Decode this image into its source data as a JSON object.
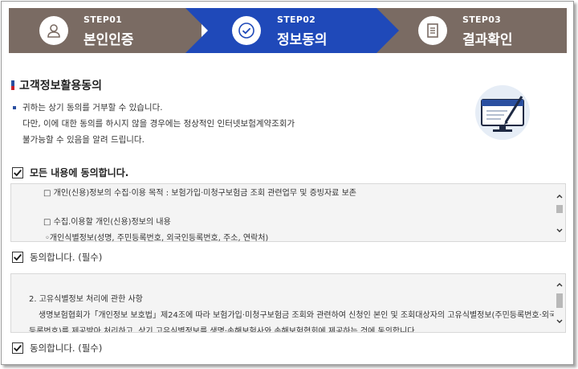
{
  "steps": [
    {
      "step": "STEP01",
      "label": "본인인증",
      "icon": "person-icon",
      "active": false
    },
    {
      "step": "STEP02",
      "label": "정보동의",
      "icon": "check-circle-icon",
      "active": true
    },
    {
      "step": "STEP03",
      "label": "결과확인",
      "icon": "document-icon",
      "active": false
    }
  ],
  "colors": {
    "inactive": "#7a6b63",
    "active": "#1f49b9",
    "accent": "#2a4fa0"
  },
  "section": {
    "title": "고객정보활용동의",
    "notice_lines": [
      "귀하는 상기 동의를 거부할 수 있습니다.",
      "다만, 이에 대한 동의를 하시지 않을 경우에는 정상적인 인터넷보험계약조회가",
      "불가능할 수 있음을 알려 드립니다."
    ]
  },
  "agree_all": {
    "label": "모든 내용에 동의합니다.",
    "checked": true
  },
  "terms1": {
    "lines": [
      "□ 개인(신용)정보의 수집·이용 목적 : 보험가입·미청구보험금 조회 관련업무 및 증빙자료 보존",
      "□ 수집.이용할 개인(신용)정보의 내용",
      "◦개인식별정보(성명, 주민등록번호, 외국인등록번호, 주소, 연락처)"
    ],
    "agree_label": "동의합니다. (필수)",
    "checked": true
  },
  "terms2": {
    "lines": [
      "2. 고유식별정보 처리에 관한 사항",
      "생명보험협회가「개인정보 보호법」제24조에 따라 보험가입·미청구보험금 조회와 관련하여 신청인 본인 및 조회대상자의 고유식별정보(주민등록번호·외국인",
      "등록번호)를 제공받아 처리하고, 상기 고유식별정보를 생명·손해보험사와 손해보험협회에 제공하는 것에 동의합니다."
    ],
    "agree_label": "동의합니다. (필수)",
    "checked": true
  }
}
